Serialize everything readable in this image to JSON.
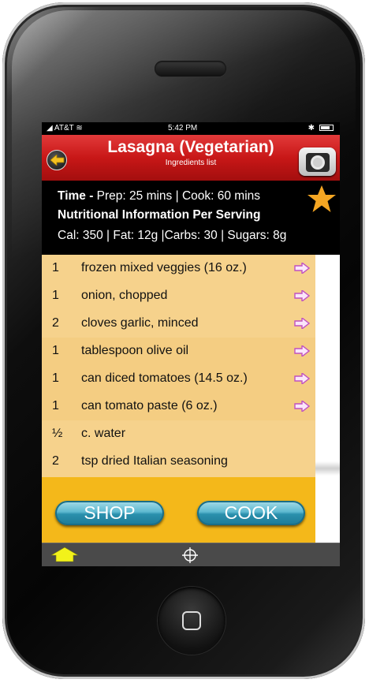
{
  "status_bar": {
    "carrier": "AT&T",
    "time": "5:42 PM"
  },
  "header": {
    "title": "Lasagna (Vegetarian)",
    "subtitle": "Ingredients list"
  },
  "info": {
    "time_label": "Time -",
    "time_value": " Prep: 25 mins | Cook: 60 mins",
    "nutrition_heading": "Nutritional Information Per Serving",
    "nutrition_values": "Cal: 350 | Fat: 12g |Carbs: 30 | Sugars: 8g"
  },
  "ingredients": [
    {
      "qty": "1",
      "name": "frozen mixed veggies (16 oz.)",
      "has_arrow": true
    },
    {
      "qty": "1",
      "name": "onion, chopped",
      "has_arrow": true
    },
    {
      "qty": "2",
      "name": "cloves garlic, minced",
      "has_arrow": true
    },
    {
      "qty": "1",
      "name": "tablespoon olive oil",
      "has_arrow": true
    },
    {
      "qty": "1",
      "name": "can diced tomatoes (14.5 oz.)",
      "has_arrow": true
    },
    {
      "qty": "1",
      "name": "can tomato paste (6 oz.)",
      "has_arrow": true
    },
    {
      "qty": "½",
      "name": "c. water",
      "has_arrow": false
    },
    {
      "qty": "2",
      "name": "tsp dried Italian seasoning",
      "has_arrow": false
    }
  ],
  "actions": {
    "shop_label": "SHOP",
    "cook_label": "COOK"
  },
  "colors": {
    "header_red": "#c81717",
    "list_bg": "#f6d28c",
    "action_bg": "#f4b81a",
    "star": "#f5a623",
    "arrow": "#c050c0",
    "button_blue": "#2a90ad"
  },
  "icons": [
    "back-arrow-icon",
    "camera-icon",
    "favorite-star-icon",
    "add-arrow-icon",
    "home-icon",
    "crosshair-icon"
  ]
}
